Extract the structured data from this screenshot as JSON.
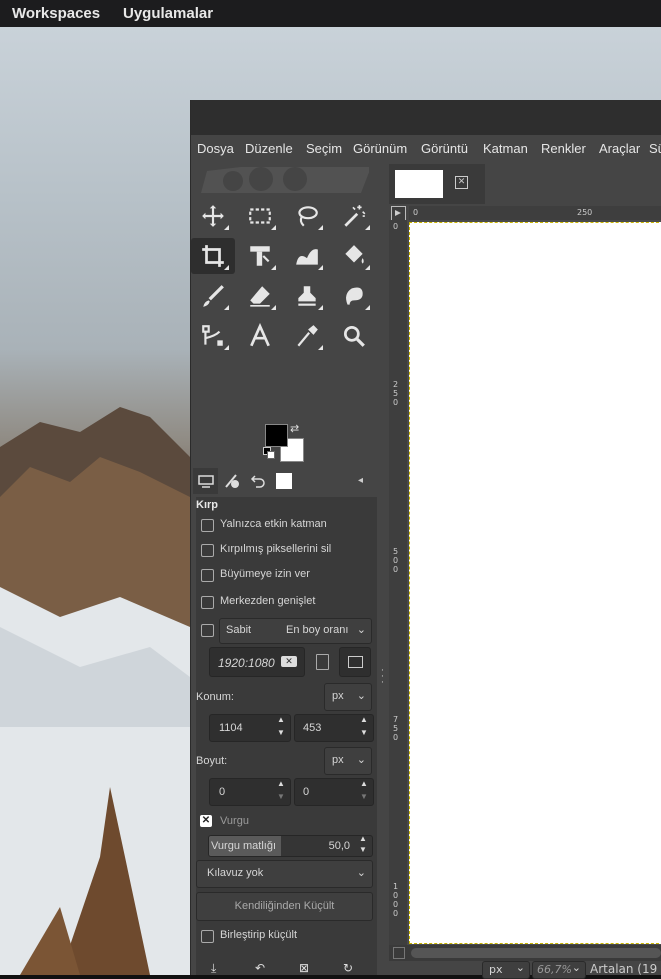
{
  "desktop_topbar": {
    "workspaces": "Workspaces",
    "apps": "Uygulamalar"
  },
  "menu": [
    "Dosya",
    "Düzenle",
    "Seçim",
    "Görünüm",
    "Görüntü",
    "Katman",
    "Renkler",
    "Araçlar",
    "Sü"
  ],
  "tools": [
    "move-tool",
    "rect-select-tool",
    "lasso-tool",
    "fuzzy-select-tool",
    "crop-tool",
    "transform-tool",
    "warp-tool",
    "bucket-fill-tool",
    "paintbrush-tool",
    "eraser-tool",
    "clone-tool",
    "smudge-tool",
    "paths-tool",
    "text-tool",
    "color-picker-tool",
    "zoom-tool"
  ],
  "options": {
    "title": "Kırp",
    "only_active_layer": "Yalnızca etkin katman",
    "delete_cropped": "Kırpılmış piksellerini sil",
    "allow_growing": "Büyümeye izin ver",
    "expand_center": "Merkezden genişlet",
    "fixed": "Sabit",
    "fixed_mode": "En boy oranı",
    "ratio_value": "1920:1080",
    "position_label": "Konum:",
    "position_unit": "px",
    "pos_x": "1104",
    "pos_y": "453",
    "size_label": "Boyut:",
    "size_unit": "px",
    "size_w": "0",
    "size_h": "0",
    "highlight": "Vurgu",
    "highlight_opacity_label": "Vurgu matlığı",
    "highlight_opacity_value": "50,0",
    "guides": "Kılavuz yok",
    "auto_shrink": "Kendiliğinden Küçült",
    "shrink_merged": "Birleştirip küçült"
  },
  "ruler": {
    "h_0": "0",
    "h_250": "250",
    "v": [
      "0",
      "250",
      "500",
      "750",
      "1000"
    ]
  },
  "statusbar": {
    "unit": "px",
    "zoom": "66,7%",
    "text": "Artalan (19"
  }
}
